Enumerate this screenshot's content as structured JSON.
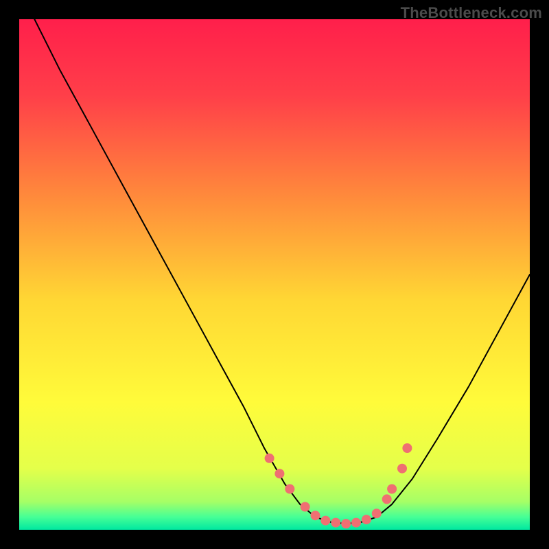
{
  "watermark": "TheBottleneck.com",
  "chart_data": {
    "type": "line",
    "title": "",
    "xlabel": "",
    "ylabel": "",
    "xlim": [
      0,
      100
    ],
    "ylim": [
      0,
      100
    ],
    "grid": false,
    "legend": false,
    "background_gradient_stops": [
      {
        "offset": 0.0,
        "color": "#ff1f4b"
      },
      {
        "offset": 0.15,
        "color": "#ff3f49"
      },
      {
        "offset": 0.35,
        "color": "#ff8b3b"
      },
      {
        "offset": 0.55,
        "color": "#ffd734"
      },
      {
        "offset": 0.75,
        "color": "#fffb3a"
      },
      {
        "offset": 0.88,
        "color": "#e4ff4a"
      },
      {
        "offset": 0.945,
        "color": "#a6ff66"
      },
      {
        "offset": 0.975,
        "color": "#46ff96"
      },
      {
        "offset": 1.0,
        "color": "#00e8a0"
      }
    ],
    "series": [
      {
        "name": "bottleneck-curve",
        "type": "line",
        "stroke": "#000000",
        "stroke_width": 2,
        "x": [
          3,
          8,
          14,
          20,
          26,
          32,
          38,
          44,
          48,
          52,
          55,
          58,
          61,
          64,
          67,
          70,
          73,
          77,
          82,
          88,
          94,
          100
        ],
        "y": [
          100,
          90,
          79,
          68,
          57,
          46,
          35,
          24,
          16,
          9,
          5,
          2.5,
          1.5,
          1.2,
          1.5,
          2.5,
          5,
          10,
          18,
          28,
          39,
          50
        ]
      },
      {
        "name": "highlight-dots",
        "type": "scatter",
        "color": "#ef6f72",
        "radius": 7,
        "x": [
          49,
          51,
          53,
          56,
          58,
          60,
          62,
          64,
          66,
          68,
          70,
          72,
          73,
          75,
          76
        ],
        "y": [
          14,
          11,
          8,
          4.5,
          2.8,
          1.8,
          1.4,
          1.2,
          1.4,
          2.0,
          3.2,
          6.0,
          8.0,
          12.0,
          16.0
        ]
      }
    ]
  }
}
